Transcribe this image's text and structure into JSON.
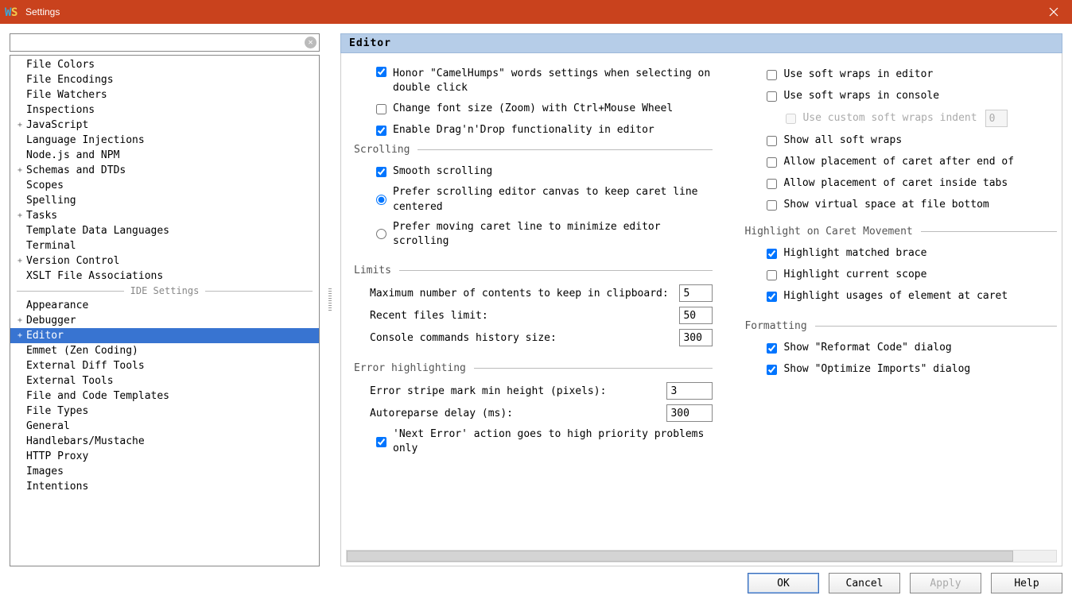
{
  "window": {
    "title": "Settings"
  },
  "tree": {
    "divider": "IDE Settings",
    "items": [
      {
        "label": "File Colors",
        "indent": 1
      },
      {
        "label": "File Encodings",
        "indent": 1
      },
      {
        "label": "File Watchers",
        "indent": 1
      },
      {
        "label": "Inspections",
        "indent": 1
      },
      {
        "label": "JavaScript",
        "indent": 1,
        "expand": "+"
      },
      {
        "label": "Language Injections",
        "indent": 1
      },
      {
        "label": "Node.js and NPM",
        "indent": 1
      },
      {
        "label": "Schemas and DTDs",
        "indent": 1,
        "expand": "+"
      },
      {
        "label": "Scopes",
        "indent": 1
      },
      {
        "label": "Spelling",
        "indent": 1
      },
      {
        "label": "Tasks",
        "indent": 1,
        "expand": "+"
      },
      {
        "label": "Template Data Languages",
        "indent": 1
      },
      {
        "label": "Terminal",
        "indent": 1
      },
      {
        "label": "Version Control",
        "indent": 1,
        "expand": "+"
      },
      {
        "label": "XSLT File Associations",
        "indent": 1
      }
    ],
    "ide_items": [
      {
        "label": "Appearance",
        "indent": 1
      },
      {
        "label": "Debugger",
        "indent": 1,
        "expand": "+"
      },
      {
        "label": "Editor",
        "indent": 1,
        "expand": "+",
        "selected": true
      },
      {
        "label": "Emmet (Zen Coding)",
        "indent": 1
      },
      {
        "label": "External Diff Tools",
        "indent": 1
      },
      {
        "label": "External Tools",
        "indent": 1
      },
      {
        "label": "File and Code Templates",
        "indent": 1
      },
      {
        "label": "File Types",
        "indent": 1
      },
      {
        "label": "General",
        "indent": 1
      },
      {
        "label": "Handlebars/Mustache",
        "indent": 1
      },
      {
        "label": "HTTP Proxy",
        "indent": 1
      },
      {
        "label": "Images",
        "indent": 1
      },
      {
        "label": "Intentions",
        "indent": 1
      }
    ]
  },
  "panel": {
    "title": "Editor"
  },
  "opts": {
    "camelhumps": "Honor \"CamelHumps\" words settings when selecting on double click",
    "ctrlwheel": "Change font size (Zoom) with Ctrl+Mouse Wheel",
    "dragdrop": "Enable Drag'n'Drop functionality in editor",
    "grp_scroll": "Scrolling",
    "smooth": "Smooth scrolling",
    "scroll_centered": "Prefer scrolling editor canvas to keep caret line centered",
    "scroll_minimize": "Prefer moving caret line to minimize editor scrolling",
    "grp_limits": "Limits",
    "clip_label": "Maximum number of contents to keep in clipboard:",
    "clip_val": "5",
    "recent_label": "Recent files limit:",
    "recent_val": "50",
    "hist_label": "Console commands history size:",
    "hist_val": "300",
    "grp_err": "Error highlighting",
    "stripe_label": "Error stripe mark min height (pixels):",
    "stripe_val": "3",
    "autoreparse_label": "Autoreparse delay (ms):",
    "autoreparse_val": "300",
    "nexterr": "'Next Error' action goes to high priority problems only",
    "softwrap_editor": "Use soft wraps in editor",
    "softwrap_console": "Use soft wraps in console",
    "softwrap_indent": "Use custom soft wraps indent",
    "softwrap_indent_val": "0",
    "showall_softwraps": "Show all soft wraps",
    "caret_afterend": "Allow placement of caret after end of",
    "caret_tabs": "Allow placement of caret inside tabs",
    "virtual_bottom": "Show virtual space at file bottom",
    "grp_highlight": "Highlight on Caret Movement",
    "hl_brace": "Highlight matched brace",
    "hl_scope": "Highlight current scope",
    "hl_usages": "Highlight usages of element at caret",
    "grp_fmt": "Formatting",
    "reformat": "Show \"Reformat Code\" dialog",
    "optimize": "Show \"Optimize Imports\" dialog"
  },
  "buttons": {
    "ok": "OK",
    "cancel": "Cancel",
    "apply": "Apply",
    "help": "Help"
  }
}
